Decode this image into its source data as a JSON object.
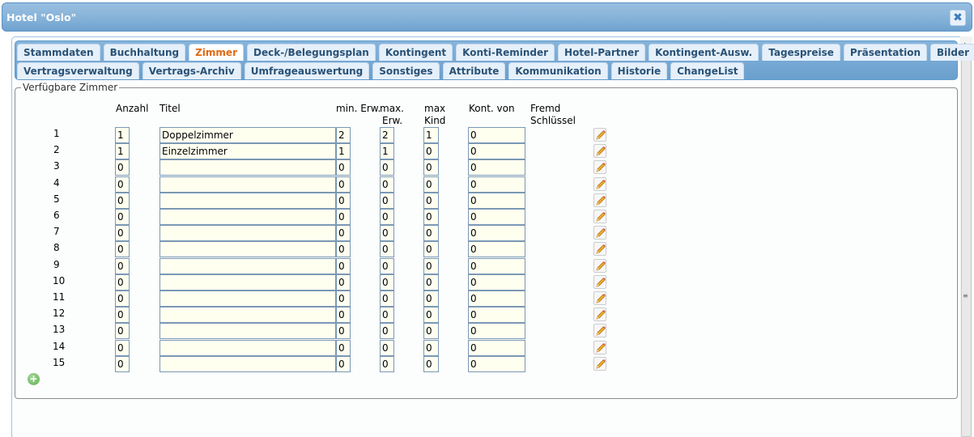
{
  "window": {
    "title": "Hotel \"Oslo\"",
    "close_icon": "close-icon"
  },
  "tabs": {
    "row1": [
      "Stammdaten",
      "Buchhaltung",
      "Zimmer",
      "Deck-/Belegungsplan",
      "Kontingent",
      "Konti-Reminder",
      "Hotel-Partner",
      "Kontingent-Ausw.",
      "Tagespreise",
      "Präsentation",
      "Bilder"
    ],
    "row2": [
      "Vertragsverwaltung",
      "Vertrags-Archiv",
      "Umfrageauswertung",
      "Sonstiges",
      "Attribute",
      "Kommunikation",
      "Historie",
      "ChangeList"
    ],
    "active": "Zimmer"
  },
  "section": {
    "legend": "Verfügbare Zimmer"
  },
  "table": {
    "headers": {
      "anzahl": "Anzahl",
      "titel": "Titel",
      "min_erw": "min. Erw.",
      "max_erw_1": "max.",
      "max_erw_2": "Erw.",
      "max_kind_1": "max",
      "max_kind_2": "Kind",
      "kont_von": "Kont. von",
      "fremd_1": "Fremd",
      "fremd_2": "Schlüssel"
    },
    "rows": [
      {
        "nr": "1",
        "anzahl": "1",
        "titel": "Doppelzimmer",
        "min_erw": "2",
        "max_erw": "2",
        "max_kind": "1",
        "kont_von": "0"
      },
      {
        "nr": "2",
        "anzahl": "1",
        "titel": "Einzelzimmer",
        "min_erw": "1",
        "max_erw": "1",
        "max_kind": "0",
        "kont_von": "0"
      },
      {
        "nr": "3",
        "anzahl": "0",
        "titel": "",
        "min_erw": "0",
        "max_erw": "0",
        "max_kind": "0",
        "kont_von": "0"
      },
      {
        "nr": "4",
        "anzahl": "0",
        "titel": "",
        "min_erw": "0",
        "max_erw": "0",
        "max_kind": "0",
        "kont_von": "0"
      },
      {
        "nr": "5",
        "anzahl": "0",
        "titel": "",
        "min_erw": "0",
        "max_erw": "0",
        "max_kind": "0",
        "kont_von": "0"
      },
      {
        "nr": "6",
        "anzahl": "0",
        "titel": "",
        "min_erw": "0",
        "max_erw": "0",
        "max_kind": "0",
        "kont_von": "0"
      },
      {
        "nr": "7",
        "anzahl": "0",
        "titel": "",
        "min_erw": "0",
        "max_erw": "0",
        "max_kind": "0",
        "kont_von": "0"
      },
      {
        "nr": "8",
        "anzahl": "0",
        "titel": "",
        "min_erw": "0",
        "max_erw": "0",
        "max_kind": "0",
        "kont_von": "0"
      },
      {
        "nr": "9",
        "anzahl": "0",
        "titel": "",
        "min_erw": "0",
        "max_erw": "0",
        "max_kind": "0",
        "kont_von": "0"
      },
      {
        "nr": "10",
        "anzahl": "0",
        "titel": "",
        "min_erw": "0",
        "max_erw": "0",
        "max_kind": "0",
        "kont_von": "0"
      },
      {
        "nr": "11",
        "anzahl": "0",
        "titel": "",
        "min_erw": "0",
        "max_erw": "0",
        "max_kind": "0",
        "kont_von": "0"
      },
      {
        "nr": "12",
        "anzahl": "0",
        "titel": "",
        "min_erw": "0",
        "max_erw": "0",
        "max_kind": "0",
        "kont_von": "0"
      },
      {
        "nr": "13",
        "anzahl": "0",
        "titel": "",
        "min_erw": "0",
        "max_erw": "0",
        "max_kind": "0",
        "kont_von": "0"
      },
      {
        "nr": "14",
        "anzahl": "0",
        "titel": "",
        "min_erw": "0",
        "max_erw": "0",
        "max_kind": "0",
        "kont_von": "0"
      },
      {
        "nr": "15",
        "anzahl": "0",
        "titel": "",
        "min_erw": "0",
        "max_erw": "0",
        "max_kind": "0",
        "kont_von": "0"
      }
    ],
    "edit_icon": "pencil-icon",
    "add_icon": "add-circle-icon"
  },
  "colors": {
    "accent": "#e06a10",
    "titlebar": "#86b2d8",
    "input_bg": "#fffff0"
  }
}
